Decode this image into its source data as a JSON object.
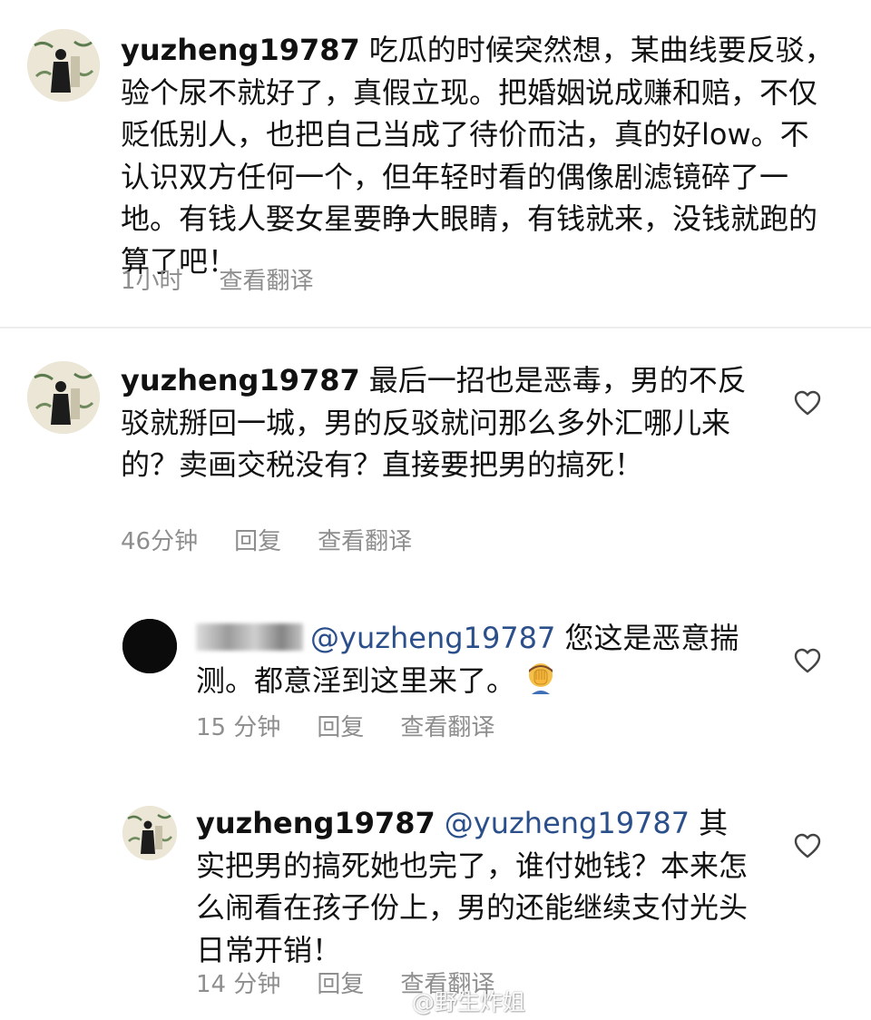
{
  "comments": [
    {
      "username": "yuzheng19787",
      "text": "吃瓜的时候突然想，某曲线要反驳，验个尿不就好了，真假立现。把婚姻说成赚和赔，不仅贬低别人，也把自己当成了待价而沽，真的好low。不认识双方任何一个，但年轻时看的偶像剧滤镜碎了一地。有钱人娶女星要睁大眼睛，有钱就来，没钱就跑的算了吧！",
      "time": "1小时",
      "translate": "查看翻译"
    },
    {
      "username": "yuzheng19787",
      "text": "最后一招也是恶毒，男的不反驳就掰回一城，男的反驳就问那么多外汇哪儿来的？卖画交税没有？直接要把男的搞死！",
      "time": "46分钟",
      "reply": "回复",
      "translate": "查看翻译"
    },
    {
      "username_partial": "nbuker",
      "mention": "@yuzheng19787",
      "text": "您这是恶意揣测。都意淫到这里来了。",
      "emoji": "facepalm-emoji",
      "time": "15 分钟",
      "reply": "回复",
      "translate": "查看翻译"
    },
    {
      "username": "yuzheng19787",
      "mention": "@yuzheng19787",
      "text": "其实把男的搞死她也完了，谁付她钱？本来怎么闹看在孩子份上，男的还能继续支付光头日常开销！",
      "time": "14 分钟",
      "reply": "回复",
      "translate": "查看翻译"
    }
  ],
  "watermark": {
    "text": "@野生炸姐",
    "icon": "weibo-icon"
  },
  "colors": {
    "mention": "#2b4f8a",
    "meta": "#8e8e8e",
    "text": "#111111",
    "divider": "#ececec"
  }
}
